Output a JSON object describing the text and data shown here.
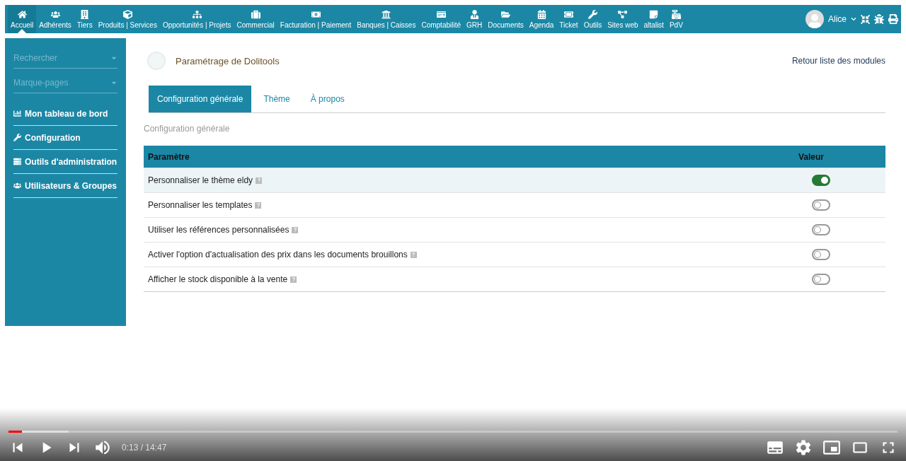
{
  "top_menu": [
    {
      "label": "Accueil",
      "selected": true
    },
    {
      "label": "Adhérents",
      "selected": false
    },
    {
      "label": "Tiers",
      "selected": false
    },
    {
      "label": "Produits | Services",
      "selected": false
    },
    {
      "label": "Opportunités | Projets",
      "selected": false
    },
    {
      "label": "Commercial",
      "selected": false
    },
    {
      "label": "Facturation | Paiement",
      "selected": false
    },
    {
      "label": "Banques | Caisses",
      "selected": false
    },
    {
      "label": "Comptabilité",
      "selected": false
    },
    {
      "label": "GRH",
      "selected": false
    },
    {
      "label": "Documents",
      "selected": false
    },
    {
      "label": "Agenda",
      "selected": false
    },
    {
      "label": "Ticket",
      "selected": false
    },
    {
      "label": "Outils",
      "selected": false
    },
    {
      "label": "Sites web",
      "selected": false
    },
    {
      "label": "altalist",
      "selected": false
    },
    {
      "label": "PdV",
      "selected": false
    }
  ],
  "user": {
    "name": "Alice"
  },
  "sidebar": {
    "search_placeholder": "Rechercher",
    "bookmarks_placeholder": "Marque-pages",
    "items": [
      {
        "label": "Mon tableau de bord"
      },
      {
        "label": "Configuration"
      },
      {
        "label": "Outils d'administration"
      },
      {
        "label": "Utilisateurs & Groupes"
      }
    ]
  },
  "page": {
    "title": "Paramétrage de Dolitools",
    "back_link": "Retour liste des modules",
    "tabs": [
      {
        "label": "Configuration générale",
        "selected": true
      },
      {
        "label": "Thème",
        "selected": false
      },
      {
        "label": "À propos",
        "selected": false
      }
    ],
    "section_title": "Configuration générale",
    "table": {
      "columns": [
        "Paramètre",
        "Valeur"
      ],
      "rows": [
        {
          "label": "Personnaliser le thème eldy",
          "on": true,
          "hovered": true
        },
        {
          "label": "Personnaliser les templates",
          "on": false,
          "hovered": false
        },
        {
          "label": "Utiliser les références personnalisées",
          "on": false,
          "hovered": false
        },
        {
          "label": "Activer l'option d'actualisation des prix dans les documents brouillons",
          "on": false,
          "hovered": false
        },
        {
          "label": "Afficher le stock disponible à la vente",
          "on": false,
          "hovered": false
        }
      ]
    }
  },
  "player": {
    "time": "0:13 / 14:47",
    "progress": {
      "level": 0.015
    }
  }
}
